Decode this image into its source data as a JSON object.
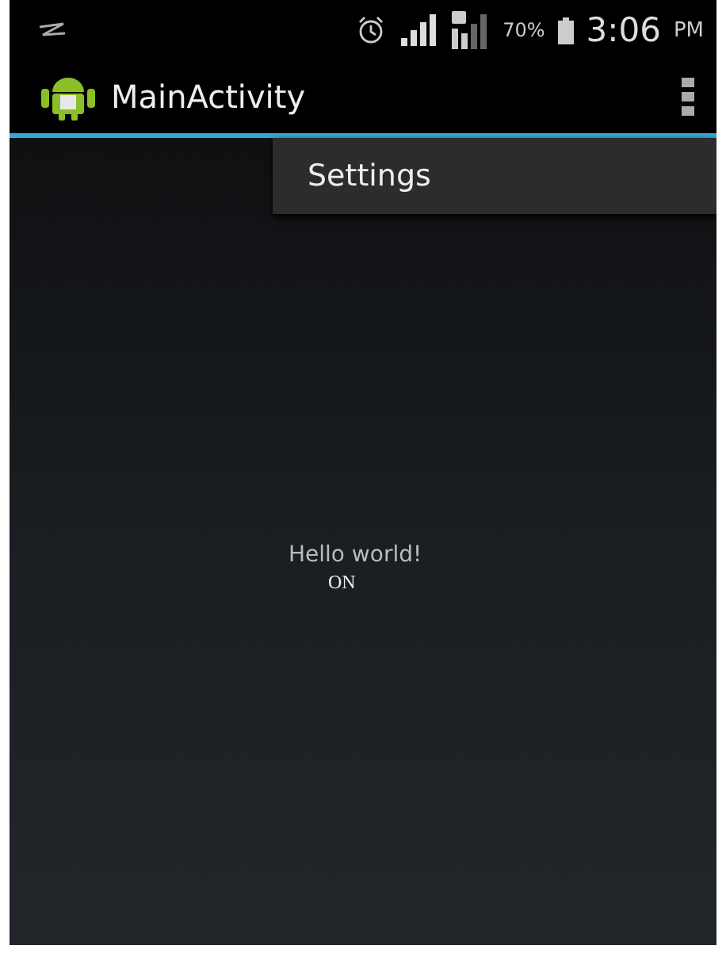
{
  "status_bar": {
    "battery": "70%",
    "time": "3:06",
    "meridiem": "PM"
  },
  "action_bar": {
    "title": "MainActivity"
  },
  "overflow_menu": {
    "items": [
      {
        "label": "Settings"
      }
    ]
  },
  "content": {
    "message": "Hello world!",
    "state_label": "ON"
  }
}
